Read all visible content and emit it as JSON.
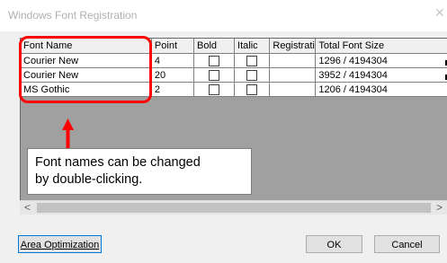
{
  "window": {
    "title": "Windows Font Registration",
    "close_glyph": "✕"
  },
  "grid": {
    "headers": [
      "Font Name",
      "Point",
      "Bold",
      "Italic",
      "Registrati",
      "Total Font Size"
    ],
    "rows": [
      {
        "font_name": "Courier New",
        "point": "4",
        "bold": false,
        "italic": false,
        "registration": "",
        "total_font_size": "1296 / 4194304"
      },
      {
        "font_name": "Courier New",
        "point": "20",
        "bold": false,
        "italic": false,
        "registration": "",
        "total_font_size": "3952 / 4194304"
      },
      {
        "font_name": "MS Gothic",
        "point": "2",
        "bold": false,
        "italic": false,
        "registration": "",
        "total_font_size": "1206 / 4194304"
      }
    ]
  },
  "scrollbar": {
    "left_glyph": "<",
    "right_glyph": ">"
  },
  "callout": {
    "line1": "Font names can be changed",
    "line2": "by double-clicking.",
    "color": "#ff0000"
  },
  "buttons": {
    "area_optimization": "Area Optimization",
    "ok": "OK",
    "cancel": "Cancel"
  }
}
